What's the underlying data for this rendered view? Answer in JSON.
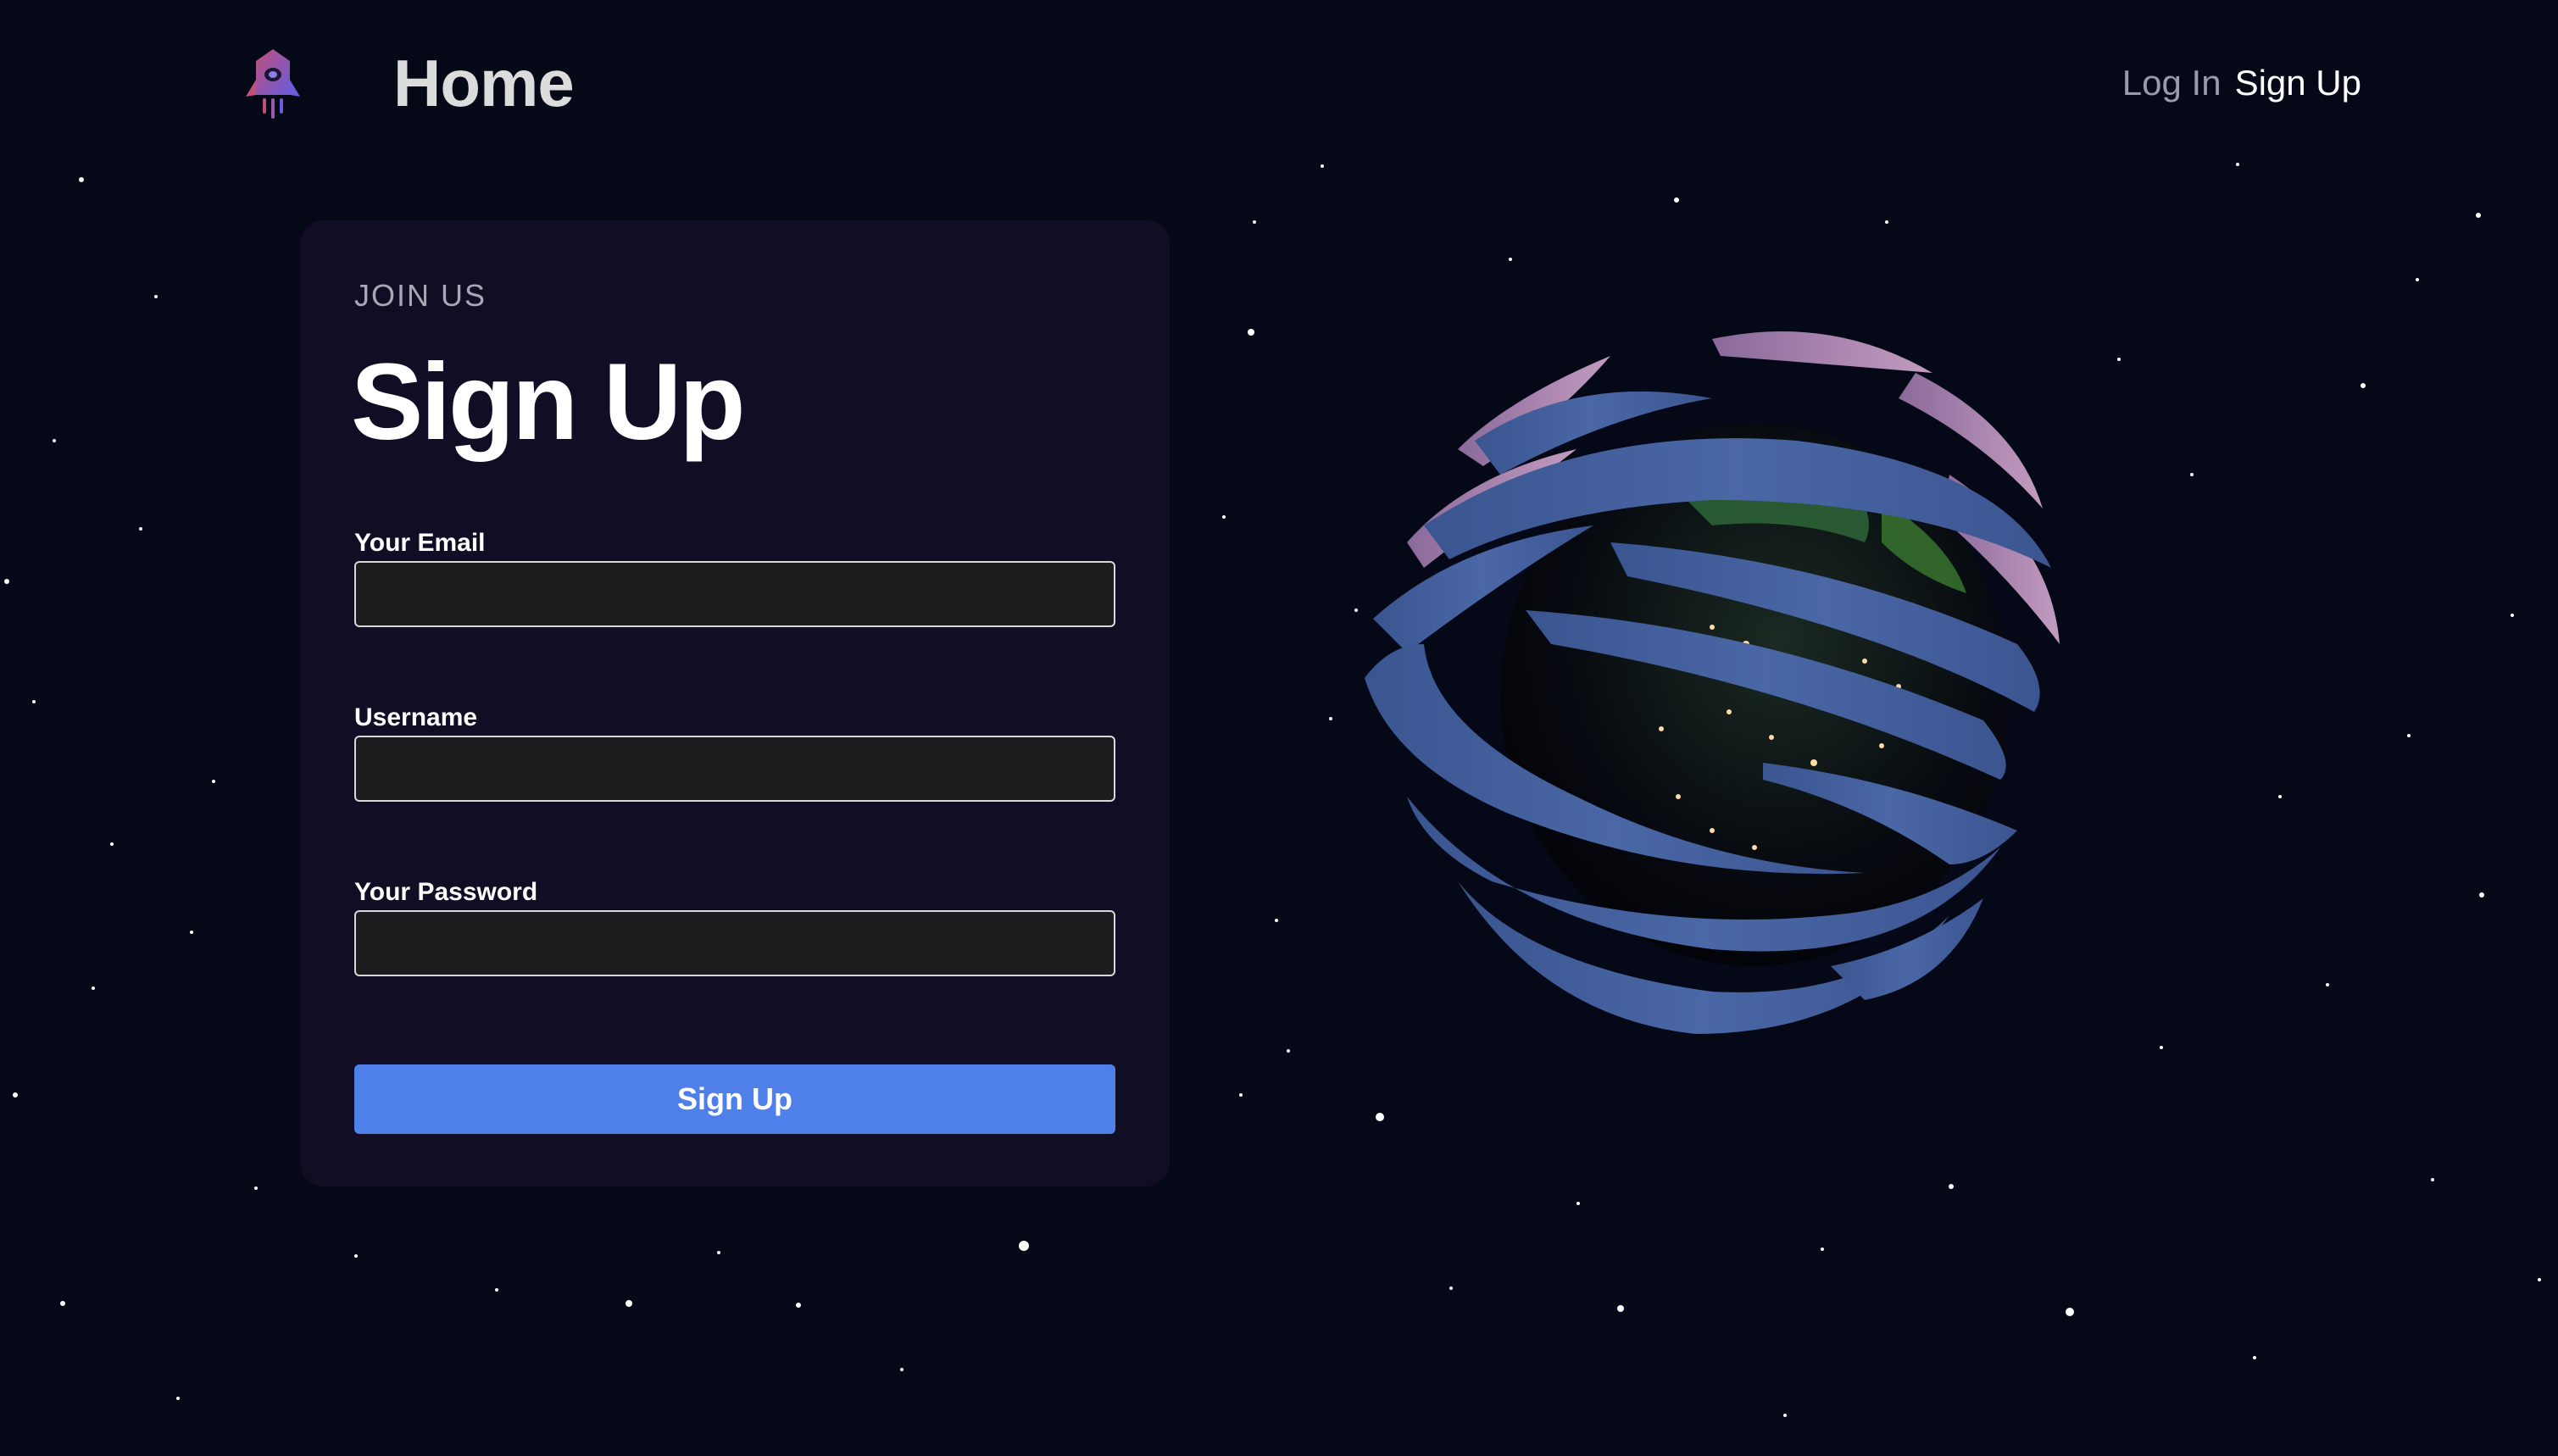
{
  "header": {
    "logo_icon": "rocket-icon",
    "home_label": "Home",
    "nav": {
      "login_label": "Log In",
      "signup_label": "Sign Up"
    }
  },
  "signup_form": {
    "eyebrow": "JOIN US",
    "title": "Sign Up",
    "fields": [
      {
        "label": "Your Email",
        "value": "",
        "placeholder": ""
      },
      {
        "label": "Username",
        "value": "",
        "placeholder": ""
      },
      {
        "label": "Your Password",
        "value": "",
        "placeholder": ""
      }
    ],
    "submit_label": "Sign Up"
  },
  "scene": {
    "globe_icon": "earth-globe-icon",
    "background_icon": "starfield-icon"
  },
  "colors": {
    "background": "#050816",
    "card": "#100d25",
    "accent": "#4f80ea",
    "input_bg": "#1d1d1f"
  }
}
